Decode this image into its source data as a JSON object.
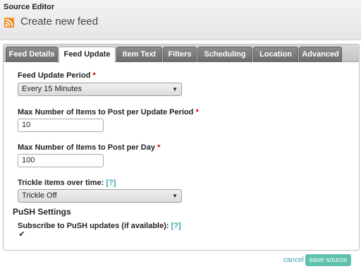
{
  "app": {
    "title": "Source Editor",
    "page_title": "Create new feed"
  },
  "tabs": [
    {
      "label": "Feed Details",
      "active": false
    },
    {
      "label": "Feed Update",
      "active": true
    },
    {
      "label": "Item Text",
      "active": false
    },
    {
      "label": "Filters",
      "active": false
    },
    {
      "label": "Scheduling",
      "active": false
    },
    {
      "label": "Location",
      "active": false
    },
    {
      "label": "Advanced",
      "active": false
    }
  ],
  "form": {
    "update_period": {
      "label": "Feed Update Period",
      "required_mark": "*",
      "value": "Every 15 Minutes"
    },
    "max_per_update": {
      "label": "Max Number of Items to Post per Update Period",
      "required_mark": "*",
      "value": "10"
    },
    "max_per_day": {
      "label": "Max Number of Items to Post per Day",
      "required_mark": "*",
      "value": "100"
    },
    "trickle": {
      "label": "Trickle items over time:",
      "help": "[?]",
      "value": "Trickle Off"
    },
    "push_heading": "PuSH Settings",
    "push_subscribe": {
      "label": "Subscribe to PuSH updates (if available):",
      "help": "[?]",
      "checked": true,
      "check_glyph": "✔"
    }
  },
  "actions": {
    "cancel_label": "cancel",
    "save_label": "save source"
  },
  "colors": {
    "accent": "#5fc1ad",
    "link": "#3a9fb0",
    "required": "#cc0000",
    "rss": "#f28c2a"
  }
}
